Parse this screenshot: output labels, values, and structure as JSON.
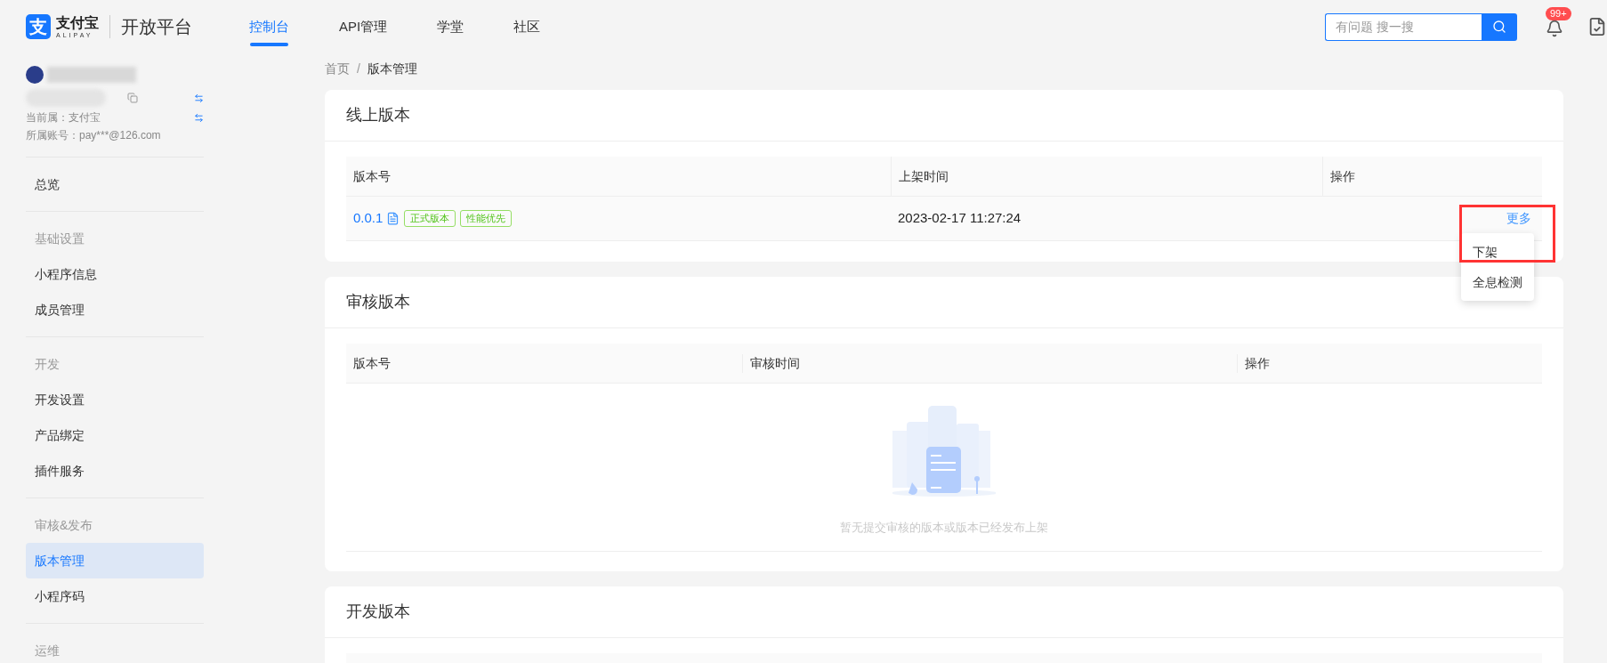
{
  "header": {
    "logo_mark": "支",
    "logo_name": "支付宝",
    "logo_sub": "ALIPAY",
    "platform": "开放平台",
    "nav": [
      {
        "label": "控制台",
        "selected": true
      },
      {
        "label": "API管理",
        "selected": false
      },
      {
        "label": "学堂",
        "selected": false
      },
      {
        "label": "社区",
        "selected": false
      }
    ],
    "search": {
      "placeholder": "有问题 搜一搜"
    },
    "notification_badge": "99+"
  },
  "sidebar": {
    "account": {
      "org_line": "当前属：支付宝",
      "email_line": "所属账号：pay***@126.com"
    },
    "groups": [
      {
        "items": [
          {
            "label": "总览",
            "selected": false
          }
        ]
      },
      {
        "title": "基础设置",
        "items": [
          {
            "label": "小程序信息",
            "selected": false
          },
          {
            "label": "成员管理",
            "selected": false
          }
        ]
      },
      {
        "title": "开发",
        "items": [
          {
            "label": "开发设置",
            "selected": false
          },
          {
            "label": "产品绑定",
            "selected": false
          },
          {
            "label": "插件服务",
            "selected": false
          }
        ]
      },
      {
        "title": "审核&发布",
        "items": [
          {
            "label": "版本管理",
            "selected": true
          },
          {
            "label": "小程序码",
            "selected": false
          }
        ]
      },
      {
        "title": "运维"
      }
    ]
  },
  "breadcrumb": [
    "首页",
    "版本管理"
  ],
  "breadcrumb_separator": "/",
  "online": {
    "title": "线上版本",
    "columns": [
      "版本号",
      "上架时间",
      "操作"
    ],
    "rows": [
      {
        "version": "0.0.1",
        "tags": [
          "正式版本",
          "性能优先"
        ],
        "time": "2023-02-17 11:27:24",
        "action": "更多",
        "highlighted": true,
        "menu": [
          "下架",
          "全息检测"
        ]
      }
    ]
  },
  "review": {
    "title": "审核版本",
    "columns": [
      "版本号",
      "审核时间",
      "操作"
    ],
    "empty_text": "暂无提交审核的版本或版本已经发布上架"
  },
  "dev": {
    "title": "开发版本"
  }
}
